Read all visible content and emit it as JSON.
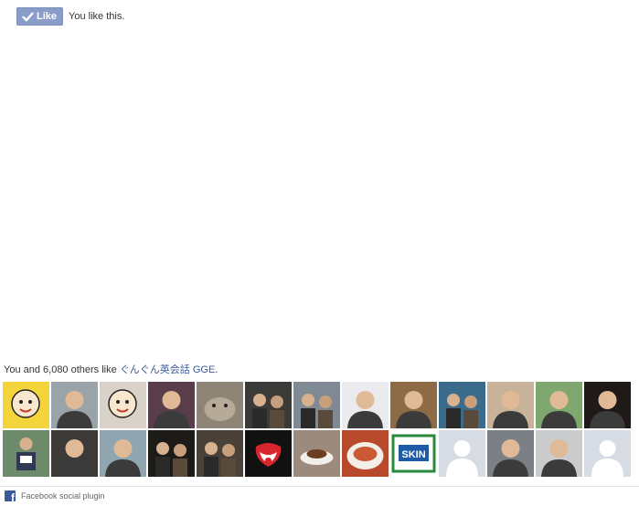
{
  "like_button": {
    "label": "Like",
    "status_text": "You like this."
  },
  "summary": {
    "prefix": "You and 6,080 others like ",
    "page_name": "ぐんぐん英会話 GGE",
    "suffix": "."
  },
  "faces": [
    {
      "icon": "cartoon-avatar",
      "bg": "#f3d43a"
    },
    {
      "icon": "child-photo",
      "bg": "#9aa3a8"
    },
    {
      "icon": "cartoon-avatar",
      "bg": "#d9d2c8"
    },
    {
      "icon": "person-photo",
      "bg": "#5a3d4a"
    },
    {
      "icon": "animal-photo",
      "bg": "#8f8577"
    },
    {
      "icon": "group-photo",
      "bg": "#3a3a38"
    },
    {
      "icon": "group-photo",
      "bg": "#7f8a94"
    },
    {
      "icon": "person-photo",
      "bg": "#e9ebee"
    },
    {
      "icon": "person-photo",
      "bg": "#8d6b44"
    },
    {
      "icon": "group-photo",
      "bg": "#3a6b8a"
    },
    {
      "icon": "person-photo",
      "bg": "#c8b39a"
    },
    {
      "icon": "person-photo",
      "bg": "#7ea86f"
    },
    {
      "icon": "person-photo",
      "bg": "#1f1a18"
    },
    {
      "icon": "runner-photo",
      "bg": "#6d8b6a"
    },
    {
      "icon": "person-photo",
      "bg": "#3c3a37"
    },
    {
      "icon": "person-photo",
      "bg": "#8fa6b1"
    },
    {
      "icon": "group-photo",
      "bg": "#1d1b18"
    },
    {
      "icon": "group-photo",
      "bg": "#4a4238"
    },
    {
      "icon": "rolling-stones-logo",
      "bg": "#111111"
    },
    {
      "icon": "coffee-photo",
      "bg": "#9c8a7c"
    },
    {
      "icon": "food-photo",
      "bg": "#b84a2c"
    },
    {
      "icon": "skin-logo",
      "bg": "#ffffff"
    },
    {
      "icon": "default-avatar",
      "bg": "#d7dbe3"
    },
    {
      "icon": "person-photo",
      "bg": "#7b8087"
    },
    {
      "icon": "person-photo",
      "bg": "#c9cbcd"
    },
    {
      "icon": "default-avatar",
      "bg": "#d7dbe3"
    }
  ],
  "footer": {
    "plugin_label": "Facebook social plugin",
    "icon": "facebook-icon"
  },
  "colors": {
    "like_button": "#8a9cc8",
    "link": "#3b5998",
    "facebook_blue": "#3b5998"
  }
}
